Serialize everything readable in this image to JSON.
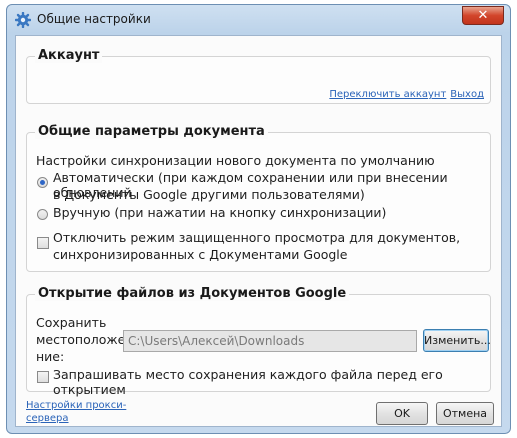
{
  "window": {
    "title": "Общие настройки",
    "close_glyph": "✕"
  },
  "account": {
    "legend": "Аккаунт",
    "switch_account_link": "Переключить аккаунт",
    "logout_link": "Выход"
  },
  "doc_params": {
    "legend": "Общие параметры документа",
    "sync_heading": "Настройки синхронизации нового документа по умолчанию",
    "radio_auto_line1": "Автоматически (при каждом сохранении или при внесении обновлений",
    "radio_auto_line2": "в Документы Google другими пользователями)",
    "radio_manual": "Вручную (при нажатии на кнопку синхронизации)",
    "checkbox_line1": "Отключить режим защищенного просмотра для документов,",
    "checkbox_line2": "синхронизированных с Документами Google",
    "selected_radio": "auto"
  },
  "open_files": {
    "legend": "Открытие файлов из Документов Google",
    "save_label_1": "Сохранить",
    "save_label_2": "местоположе",
    "save_label_3": "ние:",
    "path_value": "C:\\Users\\Алексей\\Downloads",
    "change_button": "Изменить...",
    "ask_checkbox": "Запрашивать место сохранения каждого файла перед его открытием"
  },
  "footer": {
    "proxy_link_line1": "Настройки прокси-",
    "proxy_link_line2": "сервера",
    "ok_button": "OK",
    "cancel_button": "Отмена"
  },
  "colors": {
    "link": "#2a63b8",
    "accent": "#2e66c6",
    "close": "#c2341c"
  },
  "icons": {
    "app": "gear-icon",
    "close": "close-icon"
  }
}
